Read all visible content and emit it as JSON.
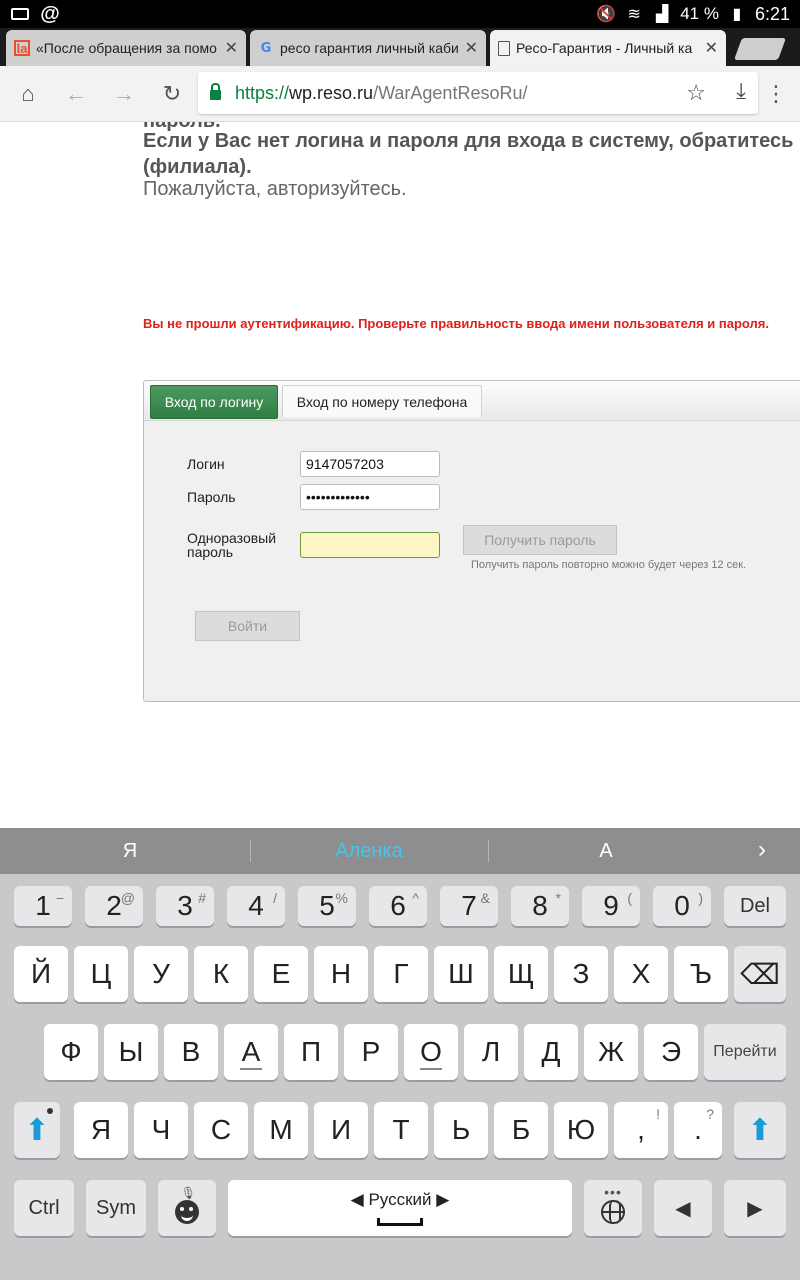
{
  "status_bar": {
    "battery": "41 %",
    "time": "6:21"
  },
  "tabs": [
    {
      "title": "«После обращения за помо",
      "close": "✕"
    },
    {
      "title": "ресо гарантия личный каби",
      "close": "✕"
    },
    {
      "title": "Ресо-Гарантия - Личный ка",
      "close": "✕"
    }
  ],
  "toolbar": {
    "url_scheme": "https://",
    "url_host": "wp.reso.ru",
    "url_path": "/WarAgentResoRu/"
  },
  "page": {
    "cut_text": "пароль.",
    "no_login_line1": "Если у Вас нет логина и пароля для входа в систему, обратитесь к",
    "no_login_line2": "(филиала).",
    "please_auth": "Пожалуйста, авторизуйтесь.",
    "auth_error": "Вы не прошли аутентификацию. Проверьте правильность ввода имени пользователя и пароля."
  },
  "login_panel": {
    "tab_login": "Вход по логину",
    "tab_phone": "Вход по номеру телефона",
    "login_label": "Логин",
    "login_value": "9147057203",
    "password_label": "Пароль",
    "password_value": "•••••••••••••",
    "otp_label_1": "Одноразовый",
    "otp_label_2": "пароль",
    "get_password": "Получить пароль",
    "resend_note": "Получить пароль повторно можно будет через 12 сек.",
    "login_button": "Войти"
  },
  "keyboard": {
    "suggestions": [
      "Я",
      "Аленка",
      "А"
    ],
    "number_row": [
      {
        "k": "1",
        "s": "−"
      },
      {
        "k": "2",
        "s": "@"
      },
      {
        "k": "3",
        "s": "#"
      },
      {
        "k": "4",
        "s": "/"
      },
      {
        "k": "5",
        "s": "%"
      },
      {
        "k": "6",
        "s": "^"
      },
      {
        "k": "7",
        "s": "&"
      },
      {
        "k": "8",
        "s": "*"
      },
      {
        "k": "9",
        "s": "("
      },
      {
        "k": "0",
        "s": ")"
      }
    ],
    "row1": [
      "Й",
      "Ц",
      "У",
      "К",
      "Е",
      "Н",
      "Г",
      "Ш",
      "Щ",
      "З",
      "Х",
      "Ъ"
    ],
    "row2": [
      "Ф",
      "Ы",
      "В",
      "А",
      "П",
      "Р",
      "О",
      "Л",
      "Д",
      "Ж",
      "Э"
    ],
    "row3": [
      "Я",
      "Ч",
      "С",
      "М",
      "И",
      "Т",
      "Ь",
      "Б",
      "Ю"
    ],
    "del": "Del",
    "go": "Перейти",
    "comma": ",",
    "comma_alt": "!",
    "period": ".",
    "period_alt": "?",
    "ctrl": "Ctrl",
    "sym": "Sym",
    "language": "Русский"
  },
  "colors": {
    "accent_green": "#2f7f45",
    "error_red": "#e0201a",
    "suggestion_blue": "#46c4ea",
    "shift_blue": "#1a9ad6"
  }
}
